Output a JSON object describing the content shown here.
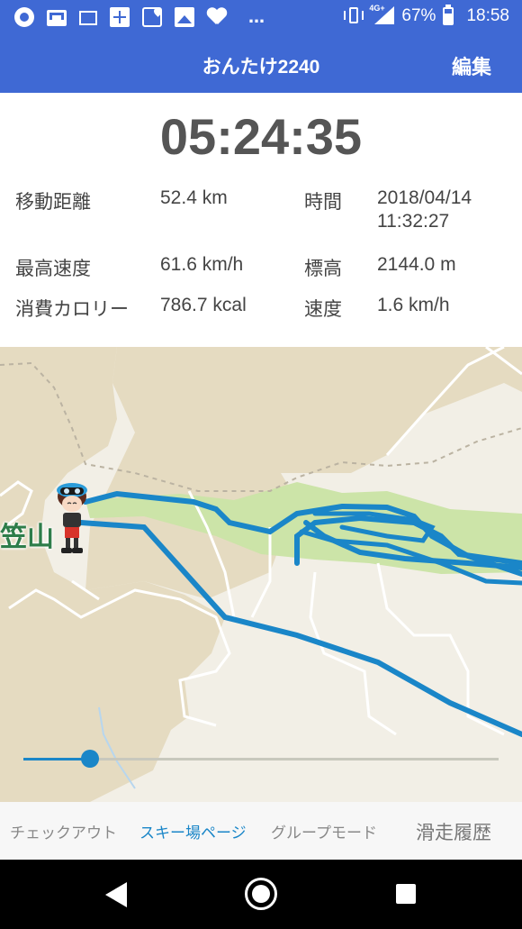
{
  "status_bar": {
    "icons": [
      "sync-icon",
      "gmail-icon",
      "mail-icon",
      "app-grid-icon",
      "maps-icon",
      "image-icon",
      "heart-icon",
      "more-icon"
    ],
    "more": "…",
    "network": "4G+",
    "battery": "67%",
    "time": "18:58"
  },
  "app_bar": {
    "title": "おんたけ2240",
    "edit_label": "編集"
  },
  "stats": {
    "elapsed": "05:24:35",
    "distance_label": "移動距離",
    "distance_value": "52.4 km",
    "time_label": "時間",
    "time_date": "2018/04/14",
    "time_clock": "11:32:27",
    "max_speed_label": "最高速度",
    "max_speed_value": "61.6 km/h",
    "altitude_label": "標高",
    "altitude_value": "2144.0 m",
    "calories_label": "消費カロリー",
    "calories_value": "786.7 kcal",
    "speed_label": "速度",
    "speed_value": "1.6 km/h"
  },
  "map": {
    "place_label": "笠山",
    "route_color": "#1a86c8",
    "playback_position": 0.14
  },
  "tabs": [
    {
      "label": "チェックアウト"
    },
    {
      "label": "スキー場ページ"
    },
    {
      "label": "グループモード"
    },
    {
      "label": "滑走履歴"
    }
  ],
  "colors": {
    "primary": "#3f69d4",
    "accent": "#1a86c8"
  }
}
